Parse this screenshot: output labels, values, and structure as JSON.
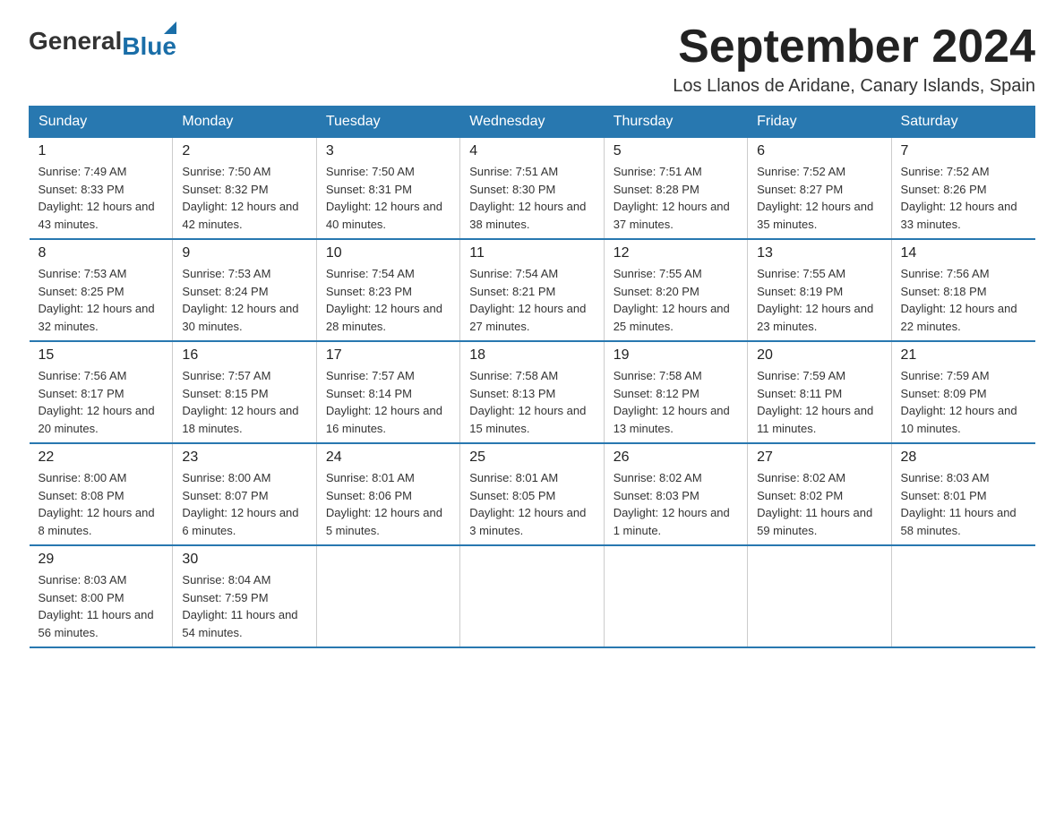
{
  "logo": {
    "general": "General",
    "arrow": "",
    "blue": "Blue"
  },
  "title": "September 2024",
  "subtitle": "Los Llanos de Aridane, Canary Islands, Spain",
  "days_of_week": [
    "Sunday",
    "Monday",
    "Tuesday",
    "Wednesday",
    "Thursday",
    "Friday",
    "Saturday"
  ],
  "weeks": [
    [
      {
        "day": "1",
        "sunrise": "7:49 AM",
        "sunset": "8:33 PM",
        "daylight": "12 hours and 43 minutes."
      },
      {
        "day": "2",
        "sunrise": "7:50 AM",
        "sunset": "8:32 PM",
        "daylight": "12 hours and 42 minutes."
      },
      {
        "day": "3",
        "sunrise": "7:50 AM",
        "sunset": "8:31 PM",
        "daylight": "12 hours and 40 minutes."
      },
      {
        "day": "4",
        "sunrise": "7:51 AM",
        "sunset": "8:30 PM",
        "daylight": "12 hours and 38 minutes."
      },
      {
        "day": "5",
        "sunrise": "7:51 AM",
        "sunset": "8:28 PM",
        "daylight": "12 hours and 37 minutes."
      },
      {
        "day": "6",
        "sunrise": "7:52 AM",
        "sunset": "8:27 PM",
        "daylight": "12 hours and 35 minutes."
      },
      {
        "day": "7",
        "sunrise": "7:52 AM",
        "sunset": "8:26 PM",
        "daylight": "12 hours and 33 minutes."
      }
    ],
    [
      {
        "day": "8",
        "sunrise": "7:53 AM",
        "sunset": "8:25 PM",
        "daylight": "12 hours and 32 minutes."
      },
      {
        "day": "9",
        "sunrise": "7:53 AM",
        "sunset": "8:24 PM",
        "daylight": "12 hours and 30 minutes."
      },
      {
        "day": "10",
        "sunrise": "7:54 AM",
        "sunset": "8:23 PM",
        "daylight": "12 hours and 28 minutes."
      },
      {
        "day": "11",
        "sunrise": "7:54 AM",
        "sunset": "8:21 PM",
        "daylight": "12 hours and 27 minutes."
      },
      {
        "day": "12",
        "sunrise": "7:55 AM",
        "sunset": "8:20 PM",
        "daylight": "12 hours and 25 minutes."
      },
      {
        "day": "13",
        "sunrise": "7:55 AM",
        "sunset": "8:19 PM",
        "daylight": "12 hours and 23 minutes."
      },
      {
        "day": "14",
        "sunrise": "7:56 AM",
        "sunset": "8:18 PM",
        "daylight": "12 hours and 22 minutes."
      }
    ],
    [
      {
        "day": "15",
        "sunrise": "7:56 AM",
        "sunset": "8:17 PM",
        "daylight": "12 hours and 20 minutes."
      },
      {
        "day": "16",
        "sunrise": "7:57 AM",
        "sunset": "8:15 PM",
        "daylight": "12 hours and 18 minutes."
      },
      {
        "day": "17",
        "sunrise": "7:57 AM",
        "sunset": "8:14 PM",
        "daylight": "12 hours and 16 minutes."
      },
      {
        "day": "18",
        "sunrise": "7:58 AM",
        "sunset": "8:13 PM",
        "daylight": "12 hours and 15 minutes."
      },
      {
        "day": "19",
        "sunrise": "7:58 AM",
        "sunset": "8:12 PM",
        "daylight": "12 hours and 13 minutes."
      },
      {
        "day": "20",
        "sunrise": "7:59 AM",
        "sunset": "8:11 PM",
        "daylight": "12 hours and 11 minutes."
      },
      {
        "day": "21",
        "sunrise": "7:59 AM",
        "sunset": "8:09 PM",
        "daylight": "12 hours and 10 minutes."
      }
    ],
    [
      {
        "day": "22",
        "sunrise": "8:00 AM",
        "sunset": "8:08 PM",
        "daylight": "12 hours and 8 minutes."
      },
      {
        "day": "23",
        "sunrise": "8:00 AM",
        "sunset": "8:07 PM",
        "daylight": "12 hours and 6 minutes."
      },
      {
        "day": "24",
        "sunrise": "8:01 AM",
        "sunset": "8:06 PM",
        "daylight": "12 hours and 5 minutes."
      },
      {
        "day": "25",
        "sunrise": "8:01 AM",
        "sunset": "8:05 PM",
        "daylight": "12 hours and 3 minutes."
      },
      {
        "day": "26",
        "sunrise": "8:02 AM",
        "sunset": "8:03 PM",
        "daylight": "12 hours and 1 minute."
      },
      {
        "day": "27",
        "sunrise": "8:02 AM",
        "sunset": "8:02 PM",
        "daylight": "11 hours and 59 minutes."
      },
      {
        "day": "28",
        "sunrise": "8:03 AM",
        "sunset": "8:01 PM",
        "daylight": "11 hours and 58 minutes."
      }
    ],
    [
      {
        "day": "29",
        "sunrise": "8:03 AM",
        "sunset": "8:00 PM",
        "daylight": "11 hours and 56 minutes."
      },
      {
        "day": "30",
        "sunrise": "8:04 AM",
        "sunset": "7:59 PM",
        "daylight": "11 hours and 54 minutes."
      },
      null,
      null,
      null,
      null,
      null
    ]
  ]
}
